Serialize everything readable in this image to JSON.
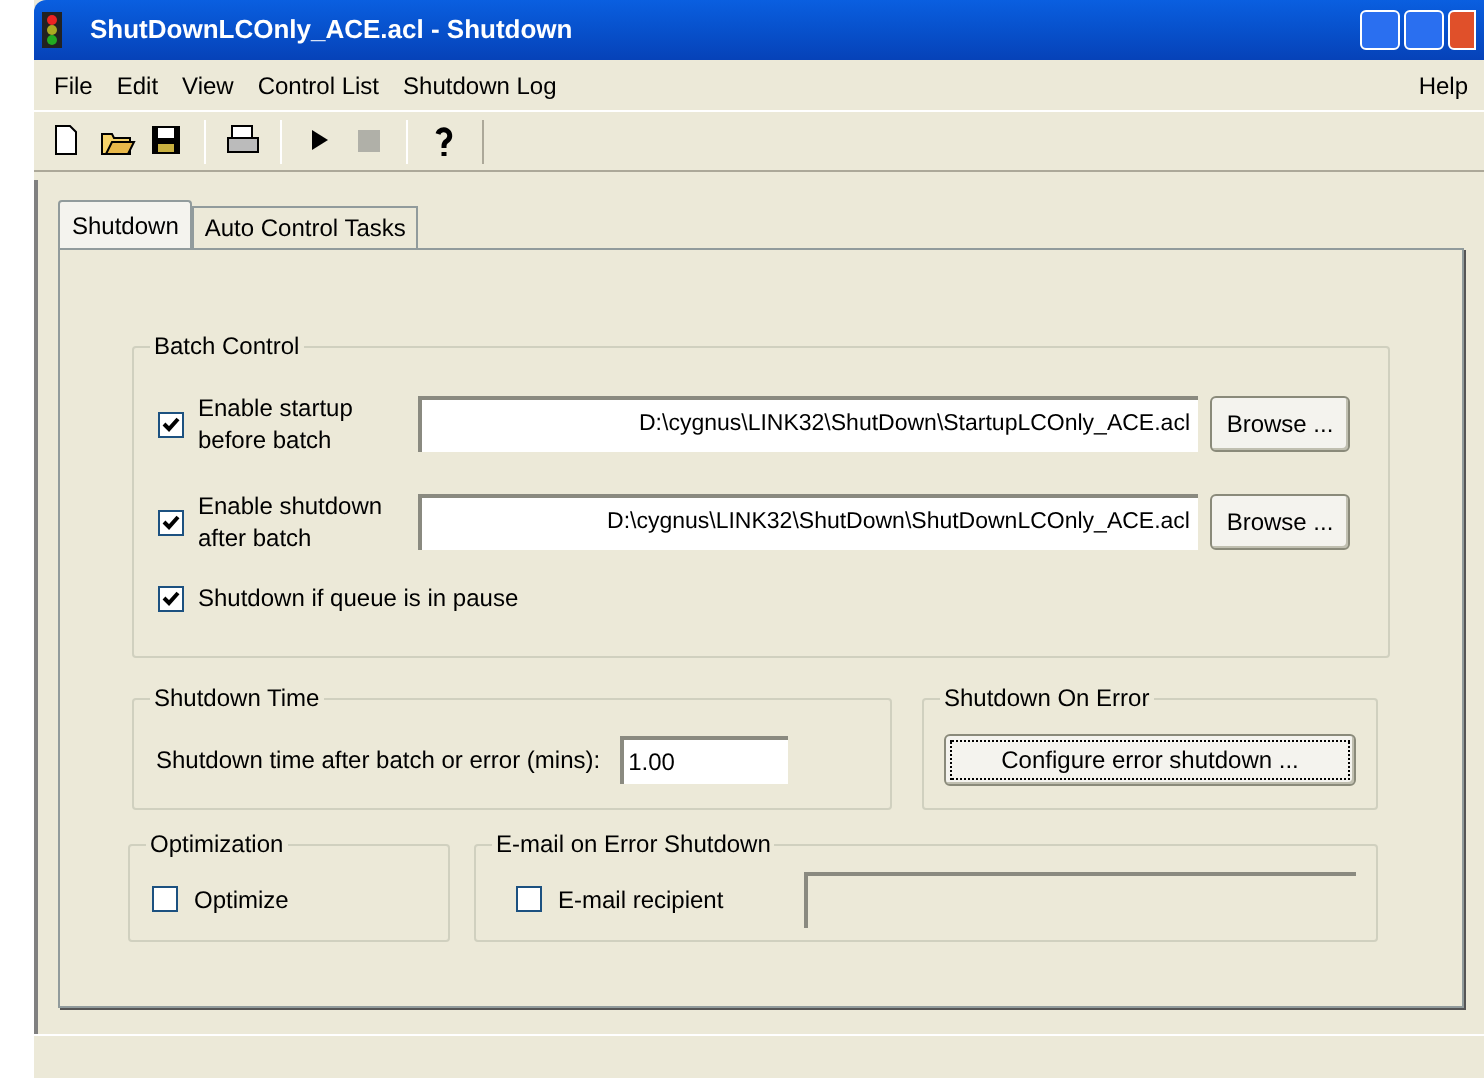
{
  "window": {
    "title": "ShutDownLCOnly_ACE.acl - Shutdown"
  },
  "menu": [
    "File",
    "Edit",
    "View",
    "Control List",
    "Shutdown Log"
  ],
  "help_menu": "Help",
  "toolbar": [
    {
      "kind": "new"
    },
    {
      "kind": "open"
    },
    {
      "kind": "save"
    },
    {
      "kind": "sep"
    },
    {
      "kind": "print"
    },
    {
      "kind": "sep"
    },
    {
      "kind": "run"
    },
    {
      "kind": "stop",
      "disabled": true
    },
    {
      "kind": "sep"
    },
    {
      "kind": "help"
    }
  ],
  "tabs": [
    {
      "label": "Shutdown",
      "selected": true
    },
    {
      "label": "Auto Control Tasks",
      "selected": false
    }
  ],
  "batch_control": {
    "title": "Batch Control",
    "rows": [
      {
        "label": "Enable startup before batch",
        "checked": true,
        "path": "D:\\cygnus\\LINK32\\ShutDown\\StartupLCOnly_ACE.acl",
        "button": "Browse ..."
      },
      {
        "label": "Enable shutdown after batch",
        "checked": true,
        "path": "D:\\cygnus\\LINK32\\ShutDown\\ShutDownLCOnly_ACE.acl",
        "button": "Browse ..."
      }
    ],
    "pause": {
      "label": "Shutdown if queue is in pause",
      "checked": true
    }
  },
  "shutdown_time": {
    "title": "Shutdown Time",
    "label": "Shutdown time after batch or error (mins):",
    "value": "1.00"
  },
  "shutdown_on_error": {
    "title": "Shutdown On Error",
    "button": "Configure error shutdown ..."
  },
  "optimization": {
    "title": "Optimization",
    "label": "Optimize",
    "checked": false
  },
  "email": {
    "title": "E-mail on Error Shutdown",
    "label": "E-mail recipient",
    "checked": false
  }
}
